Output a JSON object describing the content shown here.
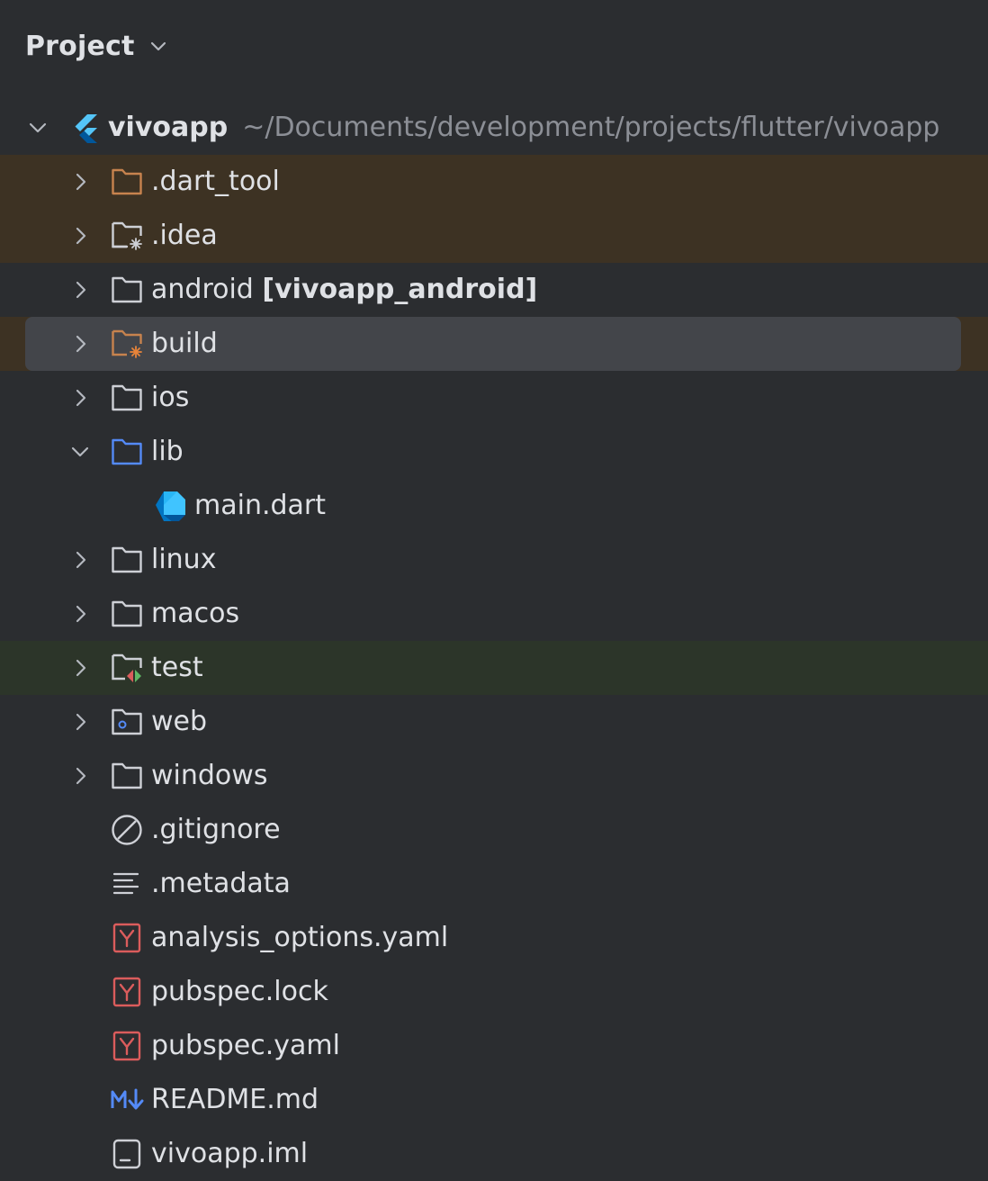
{
  "panel": {
    "title": "Project",
    "title_chevron_icon": "chevron-down-icon"
  },
  "root": {
    "name": "vivoapp",
    "path": "~/Documents/development/projects/flutter/vivoapp",
    "icon": "flutter-icon",
    "expanded": true
  },
  "items": [
    {
      "name": ".dart_tool",
      "module": "",
      "icon": "folder-excluded-icon",
      "expandable": true,
      "expanded": false
    },
    {
      "name": ".idea",
      "module": "",
      "icon": "folder-config-icon",
      "expandable": true,
      "expanded": false
    },
    {
      "name": "android",
      "module": "[vivoapp_android]",
      "icon": "folder-icon",
      "expandable": true,
      "expanded": false
    },
    {
      "name": "build",
      "module": "",
      "icon": "folder-excluded-build-icon",
      "expandable": true,
      "expanded": false
    },
    {
      "name": "ios",
      "module": "",
      "icon": "folder-icon",
      "expandable": true,
      "expanded": false
    },
    {
      "name": "lib",
      "module": "",
      "icon": "folder-source-icon",
      "expandable": true,
      "expanded": true
    },
    {
      "name": "main.dart",
      "module": "",
      "icon": "dart-file-icon",
      "expandable": false,
      "expanded": false
    },
    {
      "name": "linux",
      "module": "",
      "icon": "folder-icon",
      "expandable": true,
      "expanded": false
    },
    {
      "name": "macos",
      "module": "",
      "icon": "folder-icon",
      "expandable": true,
      "expanded": false
    },
    {
      "name": "test",
      "module": "",
      "icon": "folder-test-icon",
      "expandable": true,
      "expanded": false
    },
    {
      "name": "web",
      "module": "",
      "icon": "folder-web-icon",
      "expandable": true,
      "expanded": false
    },
    {
      "name": "windows",
      "module": "",
      "icon": "folder-icon",
      "expandable": true,
      "expanded": false
    },
    {
      "name": ".gitignore",
      "module": "",
      "icon": "ignore-file-icon",
      "expandable": false,
      "expanded": false
    },
    {
      "name": ".metadata",
      "module": "",
      "icon": "text-file-icon",
      "expandable": false,
      "expanded": false
    },
    {
      "name": "analysis_options.yaml",
      "module": "",
      "icon": "yaml-file-icon",
      "expandable": false,
      "expanded": false
    },
    {
      "name": "pubspec.lock",
      "module": "",
      "icon": "yaml-file-icon",
      "expandable": false,
      "expanded": false
    },
    {
      "name": "pubspec.yaml",
      "module": "",
      "icon": "yaml-file-icon",
      "expandable": false,
      "expanded": false
    },
    {
      "name": "README.md",
      "module": "",
      "icon": "markdown-file-icon",
      "expandable": false,
      "expanded": false
    },
    {
      "name": "vivoapp.iml",
      "module": "",
      "icon": "module-file-icon",
      "expandable": false,
      "expanded": false
    }
  ],
  "selected_item": "build",
  "colors": {
    "background": "#2b2d30",
    "text": "#dfe1e5",
    "path_text": "#8c8f96",
    "excluded_row": "#3d3223",
    "test_row": "#2c3529",
    "selection": "#43454a",
    "excluded_folder": "#c7834e",
    "source_folder": "#548af7",
    "yaml_icon": "#db5c5c",
    "markdown_icon": "#548af7"
  }
}
